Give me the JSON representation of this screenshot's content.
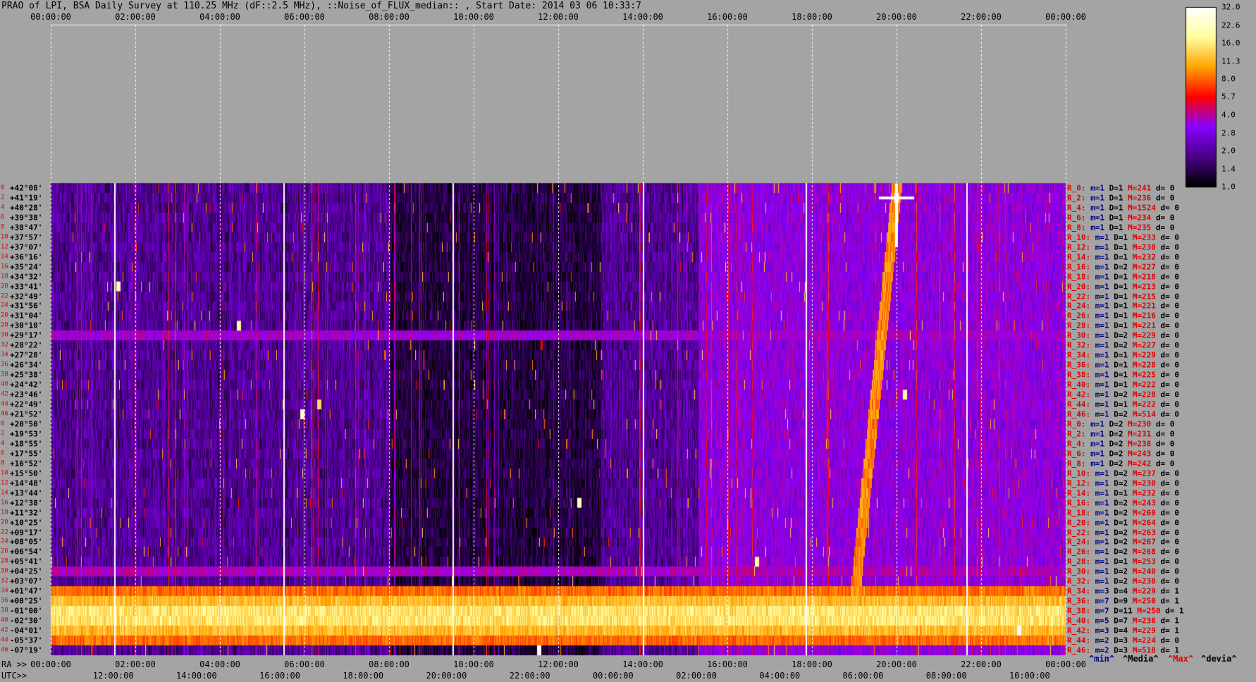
{
  "title": "PRAO of LPI, BSA Daily Survey at 110.25 MHz (dF::2.5 MHz), ::Noise_of_FLUX_median:: , Start Date: 2014 03 06 10:33:7",
  "colors": {
    "background": "#a4a4a4",
    "stop_0": "#000000",
    "stop_1": "#4a0088",
    "stop_2": "#8a00ff",
    "stop_3": "#ff0000",
    "stop_4": "#ffa500",
    "stop_5": "#ffffa0",
    "stop_6": "#ffffff"
  },
  "chart_data": {
    "type": "heatmap",
    "top_time_ticks": [
      "00:00:00",
      "02:00:00",
      "04:00:00",
      "06:00:00",
      "08:00:00",
      "10:00:00",
      "12:00:00",
      "14:00:00",
      "16:00:00",
      "18:00:00",
      "20:00:00",
      "22:00:00",
      "00:00:00"
    ],
    "bottom_ra_ticks": [
      "00:00:00",
      "02:00:00",
      "04:00:00",
      "06:00:00",
      "08:00:00",
      "10:00:00",
      "12:00:00",
      "14:00:00",
      "16:00:00",
      "18:00:00",
      "20:00:00",
      "22:00:00",
      "00:00:00"
    ],
    "bottom_utc_ticks": [
      "12:00:00",
      "14:00:00",
      "16:00:00",
      "18:00:00",
      "20:00:00",
      "22:00:00",
      "00:00:00",
      "02:00:00",
      "04:00:00",
      "06:00:00",
      "08:00:00",
      "10:00:00"
    ],
    "axis_left_ra": "RA >>",
    "axis_left_utc": "UTC>>",
    "declinations": [
      "+42°08'",
      "+41°19'",
      "+40°28'",
      "+39°38'",
      "+38°47'",
      "+37°57'",
      "+37°07'",
      "+36°16'",
      "+35°24'",
      "+34°32'",
      "+33°41'",
      "+32°49'",
      "+31°56'",
      "+31°04'",
      "+30°10'",
      "+29°17'",
      "+28°22'",
      "+27°28'",
      "+26°34'",
      "+25°38'",
      "+24°42'",
      "+23°46'",
      "+22°49'",
      "+21°52'",
      "+20°50'",
      "+19°53'",
      "+18°55'",
      "+17°55'",
      "+16°52'",
      "+15°50'",
      "+14°48'",
      "+13°44'",
      "+12°38'",
      "+11°32'",
      "+10°25'",
      "+09°17'",
      "+08°05'",
      "+06°54'",
      "+05°41'",
      "+04°25'",
      "+03°07'",
      "+01°47'",
      "+00°25'",
      "-01°00'",
      "-02°30'",
      "-04°01'",
      "-05°37'",
      "-07°19'"
    ],
    "row_indices": [
      "0",
      "2",
      "4",
      "6",
      "8",
      "10",
      "12",
      "14",
      "16",
      "18",
      "20",
      "22",
      "24",
      "26",
      "28",
      "30",
      "32",
      "34",
      "36",
      "38",
      "40",
      "42",
      "44",
      "46",
      "0",
      "2",
      "4",
      "6",
      "8",
      "10",
      "12",
      "14",
      "16",
      "18",
      "20",
      "22",
      "24",
      "26",
      "28",
      "30",
      "32",
      "34",
      "36",
      "38",
      "40",
      "42",
      "44",
      "46"
    ],
    "row_stats": [
      {
        "label": "R_0:",
        "m": "m=1",
        "D": "D=1",
        "M": "M=241",
        "d": "d= 0"
      },
      {
        "label": "R_2:",
        "m": "m=1",
        "D": "D=1",
        "M": "M=236",
        "d": "d= 0"
      },
      {
        "label": "R_4:",
        "m": "m=1",
        "D": "D=1",
        "M": "M=1524",
        "d": "d= 0"
      },
      {
        "label": "R_6:",
        "m": "m=1",
        "D": "D=1",
        "M": "M=234",
        "d": "d= 0"
      },
      {
        "label": "R_8:",
        "m": "m=1",
        "D": "D=1",
        "M": "M=235",
        "d": "d= 0"
      },
      {
        "label": "R_10:",
        "m": "m=1",
        "D": "D=1",
        "M": "M=233",
        "d": "d= 0"
      },
      {
        "label": "R_12:",
        "m": "m=1",
        "D": "D=1",
        "M": "M=230",
        "d": "d= 0"
      },
      {
        "label": "R_14:",
        "m": "m=1",
        "D": "D=1",
        "M": "M=232",
        "d": "d= 0"
      },
      {
        "label": "R_16:",
        "m": "m=1",
        "D": "D=2",
        "M": "M=227",
        "d": "d= 0"
      },
      {
        "label": "R_18:",
        "m": "m=1",
        "D": "D=1",
        "M": "M=218",
        "d": "d= 0"
      },
      {
        "label": "R_20:",
        "m": "m=1",
        "D": "D=1",
        "M": "M=213",
        "d": "d= 0"
      },
      {
        "label": "R_22:",
        "m": "m=1",
        "D": "D=1",
        "M": "M=215",
        "d": "d= 0"
      },
      {
        "label": "R_24:",
        "m": "m=1",
        "D": "D=1",
        "M": "M=221",
        "d": "d= 0"
      },
      {
        "label": "R_26:",
        "m": "m=1",
        "D": "D=1",
        "M": "M=216",
        "d": "d= 0"
      },
      {
        "label": "R_28:",
        "m": "m=1",
        "D": "D=1",
        "M": "M=221",
        "d": "d= 0"
      },
      {
        "label": "R_30:",
        "m": "m=1",
        "D": "D=2",
        "M": "M=229",
        "d": "d= 0"
      },
      {
        "label": "R_32:",
        "m": "m=1",
        "D": "D=2",
        "M": "M=227",
        "d": "d= 0"
      },
      {
        "label": "R_34:",
        "m": "m=1",
        "D": "D=1",
        "M": "M=229",
        "d": "d= 0"
      },
      {
        "label": "R_36:",
        "m": "m=1",
        "D": "D=1",
        "M": "M=228",
        "d": "d= 0"
      },
      {
        "label": "R_38:",
        "m": "m=1",
        "D": "D=1",
        "M": "M=225",
        "d": "d= 0"
      },
      {
        "label": "R_40:",
        "m": "m=1",
        "D": "D=1",
        "M": "M=222",
        "d": "d= 0"
      },
      {
        "label": "R_42:",
        "m": "m=1",
        "D": "D=2",
        "M": "M=228",
        "d": "d= 0"
      },
      {
        "label": "R_44:",
        "m": "m=1",
        "D": "D=1",
        "M": "M=222",
        "d": "d= 0"
      },
      {
        "label": "R_46:",
        "m": "m=1",
        "D": "D=2",
        "M": "M=514",
        "d": "d= 0"
      },
      {
        "label": "R_0:",
        "m": "m=1",
        "D": "D=2",
        "M": "M=230",
        "d": "d= 0"
      },
      {
        "label": "R_2:",
        "m": "m=1",
        "D": "D=2",
        "M": "M=231",
        "d": "d= 0"
      },
      {
        "label": "R_4:",
        "m": "m=1",
        "D": "D=2",
        "M": "M=238",
        "d": "d= 0"
      },
      {
        "label": "R_6:",
        "m": "m=1",
        "D": "D=2",
        "M": "M=243",
        "d": "d= 0"
      },
      {
        "label": "R_8:",
        "m": "m=1",
        "D": "D=2",
        "M": "M=242",
        "d": "d= 0"
      },
      {
        "label": "R_10:",
        "m": "m=1",
        "D": "D=2",
        "M": "M=237",
        "d": "d= 0"
      },
      {
        "label": "R_12:",
        "m": "m=1",
        "D": "D=2",
        "M": "M=230",
        "d": "d= 0"
      },
      {
        "label": "R_14:",
        "m": "m=1",
        "D": "D=1",
        "M": "M=232",
        "d": "d= 0"
      },
      {
        "label": "R_16:",
        "m": "m=1",
        "D": "D=2",
        "M": "M=243",
        "d": "d= 0"
      },
      {
        "label": "R_18:",
        "m": "m=1",
        "D": "D=2",
        "M": "M=260",
        "d": "d= 0"
      },
      {
        "label": "R_20:",
        "m": "m=1",
        "D": "D=1",
        "M": "M=264",
        "d": "d= 0"
      },
      {
        "label": "R_22:",
        "m": "m=1",
        "D": "D=2",
        "M": "M=263",
        "d": "d= 0"
      },
      {
        "label": "R_24:",
        "m": "m=1",
        "D": "D=2",
        "M": "M=267",
        "d": "d= 0"
      },
      {
        "label": "R_26:",
        "m": "m=1",
        "D": "D=2",
        "M": "M=268",
        "d": "d= 0"
      },
      {
        "label": "R_28:",
        "m": "m=1",
        "D": "D=1",
        "M": "M=253",
        "d": "d= 0"
      },
      {
        "label": "R_30:",
        "m": "m=1",
        "D": "D=2",
        "M": "M=240",
        "d": "d= 0"
      },
      {
        "label": "R_32:",
        "m": "m=1",
        "D": "D=2",
        "M": "M=230",
        "d": "d= 0"
      },
      {
        "label": "R_34:",
        "m": "m=3",
        "D": "D=4",
        "M": "M=229",
        "d": "d= 1"
      },
      {
        "label": "R_36:",
        "m": "m=7",
        "D": "D=9",
        "M": "M=250",
        "d": "d= 1"
      },
      {
        "label": "R_38:",
        "m": "m=7",
        "D": "D=11",
        "M": "M=250",
        "d": "d= 1"
      },
      {
        "label": "R_40:",
        "m": "m=5",
        "D": "D=7",
        "M": "M=236",
        "d": "d= 1"
      },
      {
        "label": "R_42:",
        "m": "m=3",
        "D": "D=4",
        "M": "M=229",
        "d": "d= 1"
      },
      {
        "label": "R_44:",
        "m": "m=2",
        "D": "D=3",
        "M": "M=224",
        "d": "d= 0"
      },
      {
        "label": "R_46:",
        "m": "m=2",
        "D": "D=3",
        "M": "M=518",
        "d": "d= 1"
      }
    ],
    "colorbar_ticks": [
      "32.0",
      "22.6",
      "16.0",
      "11.3",
      "8.0",
      "5.7",
      "4.0",
      "2.8",
      "2.0",
      "1.4",
      "1.0"
    ],
    "colorbar_range": [
      1.0,
      32.0
    ],
    "colorbar_scale": "log",
    "legend": {
      "min": "^min^",
      "media": "^Media^",
      "max": "^Max^",
      "devia": "^devia^"
    },
    "legend_colors": {
      "min": "#000080",
      "media": "#000000",
      "max": "#e00000",
      "devia": "#000000"
    },
    "time_range_hours": [
      0,
      24
    ],
    "background_level": 1.9,
    "galactic_band": {
      "rows": [
        41,
        46
      ],
      "level": 14
    },
    "faint_horizontal_band": {
      "row": 15,
      "level": 3.2
    },
    "faint_horizontal_band_2": {
      "row": 39,
      "level": 3.4
    },
    "diffuse_region": {
      "t_start": 15.3,
      "t_end": 24.0,
      "level": 3.0
    },
    "drift_track": {
      "t_start": 19.0,
      "t_end": 20.0,
      "row_start": 42,
      "row_end": 0,
      "level": 9
    },
    "sources": [
      {
        "t": 20.0,
        "row": 1,
        "level": 32,
        "type": "cross"
      },
      {
        "t": 5.95,
        "row": 23,
        "level": 24
      },
      {
        "t": 12.5,
        "row": 32,
        "level": 22
      },
      {
        "t": 6.35,
        "row": 22,
        "level": 14
      },
      {
        "t": 1.6,
        "row": 10,
        "level": 20
      },
      {
        "t": 4.45,
        "row": 14,
        "level": 18
      },
      {
        "t": 20.2,
        "row": 21,
        "level": 20
      },
      {
        "t": 22.9,
        "row": 45,
        "level": 30
      },
      {
        "t": 11.55,
        "row": 47,
        "level": 30
      },
      {
        "t": 16.7,
        "row": 38,
        "level": 18
      }
    ],
    "vertical_lines": [
      1.5,
      5.5,
      9.5,
      14.0,
      17.85,
      21.65
    ]
  }
}
